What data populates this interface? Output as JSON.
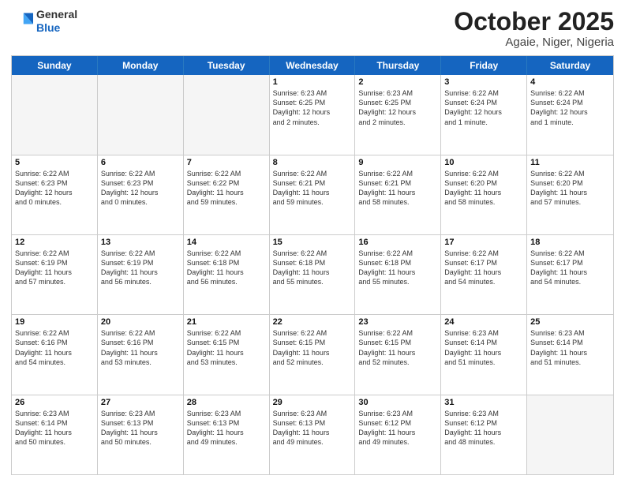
{
  "header": {
    "logo_general": "General",
    "logo_blue": "Blue",
    "month": "October 2025",
    "location": "Agaie, Niger, Nigeria"
  },
  "weekdays": [
    "Sunday",
    "Monday",
    "Tuesday",
    "Wednesday",
    "Thursday",
    "Friday",
    "Saturday"
  ],
  "rows": [
    [
      {
        "day": "",
        "text": ""
      },
      {
        "day": "",
        "text": ""
      },
      {
        "day": "",
        "text": ""
      },
      {
        "day": "1",
        "text": "Sunrise: 6:23 AM\nSunset: 6:25 PM\nDaylight: 12 hours\nand 2 minutes."
      },
      {
        "day": "2",
        "text": "Sunrise: 6:23 AM\nSunset: 6:25 PM\nDaylight: 12 hours\nand 2 minutes."
      },
      {
        "day": "3",
        "text": "Sunrise: 6:22 AM\nSunset: 6:24 PM\nDaylight: 12 hours\nand 1 minute."
      },
      {
        "day": "4",
        "text": "Sunrise: 6:22 AM\nSunset: 6:24 PM\nDaylight: 12 hours\nand 1 minute."
      }
    ],
    [
      {
        "day": "5",
        "text": "Sunrise: 6:22 AM\nSunset: 6:23 PM\nDaylight: 12 hours\nand 0 minutes."
      },
      {
        "day": "6",
        "text": "Sunrise: 6:22 AM\nSunset: 6:23 PM\nDaylight: 12 hours\nand 0 minutes."
      },
      {
        "day": "7",
        "text": "Sunrise: 6:22 AM\nSunset: 6:22 PM\nDaylight: 11 hours\nand 59 minutes."
      },
      {
        "day": "8",
        "text": "Sunrise: 6:22 AM\nSunset: 6:21 PM\nDaylight: 11 hours\nand 59 minutes."
      },
      {
        "day": "9",
        "text": "Sunrise: 6:22 AM\nSunset: 6:21 PM\nDaylight: 11 hours\nand 58 minutes."
      },
      {
        "day": "10",
        "text": "Sunrise: 6:22 AM\nSunset: 6:20 PM\nDaylight: 11 hours\nand 58 minutes."
      },
      {
        "day": "11",
        "text": "Sunrise: 6:22 AM\nSunset: 6:20 PM\nDaylight: 11 hours\nand 57 minutes."
      }
    ],
    [
      {
        "day": "12",
        "text": "Sunrise: 6:22 AM\nSunset: 6:19 PM\nDaylight: 11 hours\nand 57 minutes."
      },
      {
        "day": "13",
        "text": "Sunrise: 6:22 AM\nSunset: 6:19 PM\nDaylight: 11 hours\nand 56 minutes."
      },
      {
        "day": "14",
        "text": "Sunrise: 6:22 AM\nSunset: 6:18 PM\nDaylight: 11 hours\nand 56 minutes."
      },
      {
        "day": "15",
        "text": "Sunrise: 6:22 AM\nSunset: 6:18 PM\nDaylight: 11 hours\nand 55 minutes."
      },
      {
        "day": "16",
        "text": "Sunrise: 6:22 AM\nSunset: 6:18 PM\nDaylight: 11 hours\nand 55 minutes."
      },
      {
        "day": "17",
        "text": "Sunrise: 6:22 AM\nSunset: 6:17 PM\nDaylight: 11 hours\nand 54 minutes."
      },
      {
        "day": "18",
        "text": "Sunrise: 6:22 AM\nSunset: 6:17 PM\nDaylight: 11 hours\nand 54 minutes."
      }
    ],
    [
      {
        "day": "19",
        "text": "Sunrise: 6:22 AM\nSunset: 6:16 PM\nDaylight: 11 hours\nand 54 minutes."
      },
      {
        "day": "20",
        "text": "Sunrise: 6:22 AM\nSunset: 6:16 PM\nDaylight: 11 hours\nand 53 minutes."
      },
      {
        "day": "21",
        "text": "Sunrise: 6:22 AM\nSunset: 6:15 PM\nDaylight: 11 hours\nand 53 minutes."
      },
      {
        "day": "22",
        "text": "Sunrise: 6:22 AM\nSunset: 6:15 PM\nDaylight: 11 hours\nand 52 minutes."
      },
      {
        "day": "23",
        "text": "Sunrise: 6:22 AM\nSunset: 6:15 PM\nDaylight: 11 hours\nand 52 minutes."
      },
      {
        "day": "24",
        "text": "Sunrise: 6:23 AM\nSunset: 6:14 PM\nDaylight: 11 hours\nand 51 minutes."
      },
      {
        "day": "25",
        "text": "Sunrise: 6:23 AM\nSunset: 6:14 PM\nDaylight: 11 hours\nand 51 minutes."
      }
    ],
    [
      {
        "day": "26",
        "text": "Sunrise: 6:23 AM\nSunset: 6:14 PM\nDaylight: 11 hours\nand 50 minutes."
      },
      {
        "day": "27",
        "text": "Sunrise: 6:23 AM\nSunset: 6:13 PM\nDaylight: 11 hours\nand 50 minutes."
      },
      {
        "day": "28",
        "text": "Sunrise: 6:23 AM\nSunset: 6:13 PM\nDaylight: 11 hours\nand 49 minutes."
      },
      {
        "day": "29",
        "text": "Sunrise: 6:23 AM\nSunset: 6:13 PM\nDaylight: 11 hours\nand 49 minutes."
      },
      {
        "day": "30",
        "text": "Sunrise: 6:23 AM\nSunset: 6:12 PM\nDaylight: 11 hours\nand 49 minutes."
      },
      {
        "day": "31",
        "text": "Sunrise: 6:23 AM\nSunset: 6:12 PM\nDaylight: 11 hours\nand 48 minutes."
      },
      {
        "day": "",
        "text": ""
      }
    ]
  ]
}
